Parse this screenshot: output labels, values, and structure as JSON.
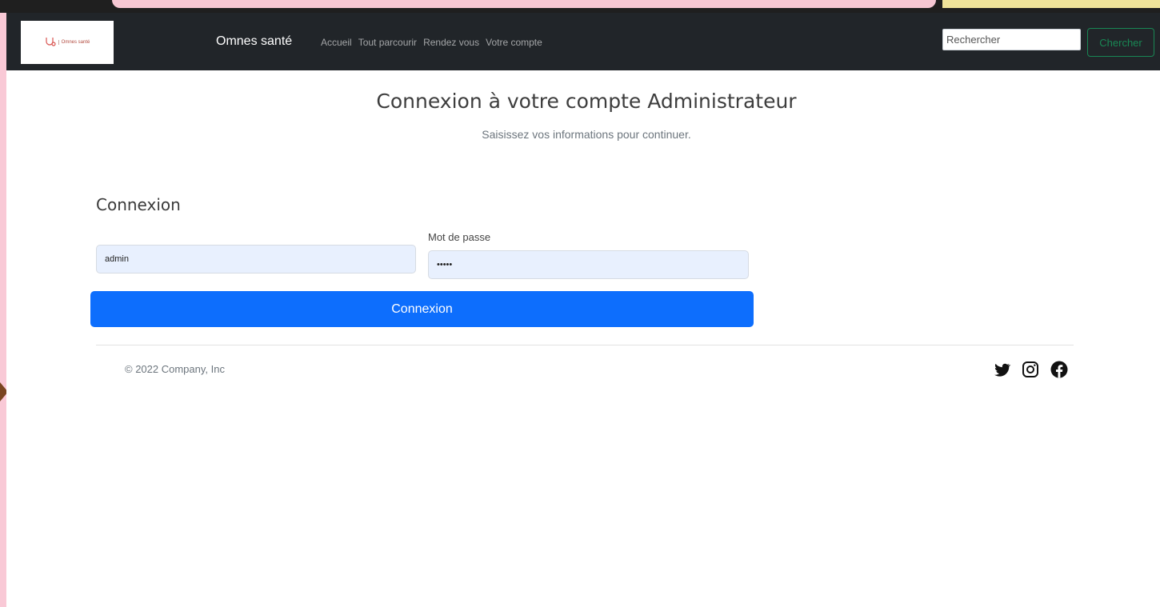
{
  "navbar": {
    "logo_text": "Omnes santé",
    "brand": "Omnes santé",
    "links": [
      "Accueil",
      "Tout parcourir",
      "Rendez vous",
      "Votre compte"
    ],
    "search_placeholder": "Rechercher",
    "search_button": "Chercher"
  },
  "header": {
    "title": "Connexion à votre compte Administrateur",
    "subtitle": "Saisissez vos informations pour continuer."
  },
  "form": {
    "section_title": "Connexion",
    "username_value": "admin",
    "password_label": "Mot de passe",
    "password_value": "admin",
    "submit_label": "Connexion"
  },
  "footer": {
    "copyright": "© 2022 Company, Inc",
    "socials": [
      "twitter-icon",
      "instagram-icon",
      "facebook-icon"
    ]
  },
  "colors": {
    "navbar_bg": "#212529",
    "primary": "#0d6efd",
    "success": "#198754",
    "autofill_bg": "#e8f0fe"
  }
}
